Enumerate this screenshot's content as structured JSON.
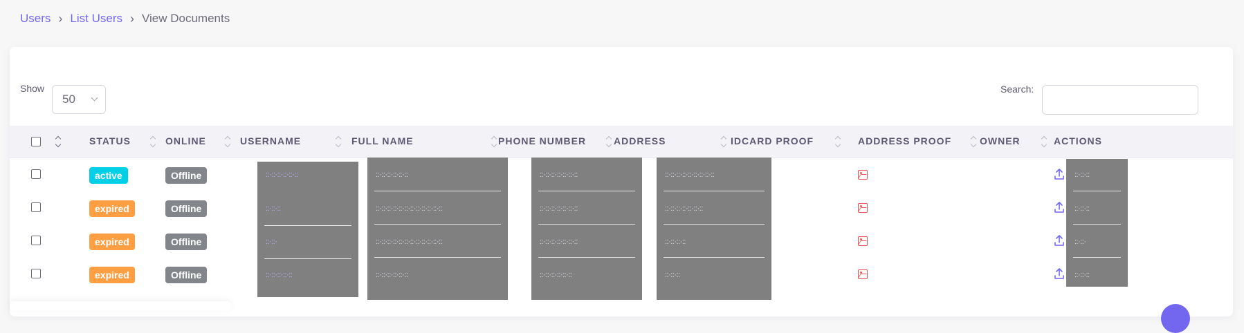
{
  "breadcrumb": {
    "items": [
      "Users",
      "List Users"
    ],
    "current": "View Documents"
  },
  "controls": {
    "show_label": "Show",
    "page_size": "50",
    "search_label": "Search:",
    "search_placeholder": ""
  },
  "table": {
    "headers": {
      "status": "Status",
      "online": "Online",
      "username": "Username",
      "full_name": "Full Name",
      "phone": "Phone Number",
      "address": "Address",
      "idcard": "IDCard Proof",
      "address_proof": "Address Proof",
      "owner": "Owner",
      "actions": "Actions"
    },
    "rows": [
      {
        "status": "active",
        "online": "Offline"
      },
      {
        "status": "expired",
        "online": "Offline"
      },
      {
        "status": "expired",
        "online": "Offline"
      },
      {
        "status": "expired",
        "online": "Offline"
      }
    ]
  },
  "icons": {
    "idcard": "image-icon",
    "address_proof": "image-icon",
    "upload": "upload-icon",
    "download": "download-icon"
  },
  "colors": {
    "accent": "#7367f0",
    "active": "#00cfe8",
    "expired": "#ff9f43",
    "offline": "#82868b",
    "image_icon": "#ea5455",
    "redaction": "#808080"
  }
}
